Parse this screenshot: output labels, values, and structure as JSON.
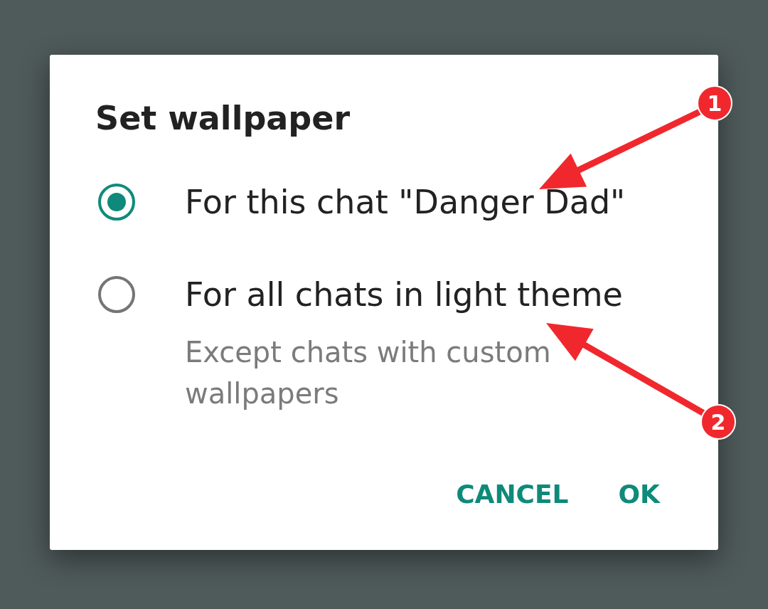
{
  "dialog": {
    "title": "Set wallpaper",
    "options": [
      {
        "label": "For this chat \"Danger Dad\"",
        "selected": true
      },
      {
        "label": "For all chats in light theme",
        "description": "Except chats with custom wallpapers",
        "selected": false
      }
    ],
    "buttons": [
      "CANCEL",
      "OK"
    ]
  },
  "annotations": [
    {
      "kind": "arrow",
      "label": "1"
    },
    {
      "kind": "arrow",
      "label": "2"
    }
  ]
}
